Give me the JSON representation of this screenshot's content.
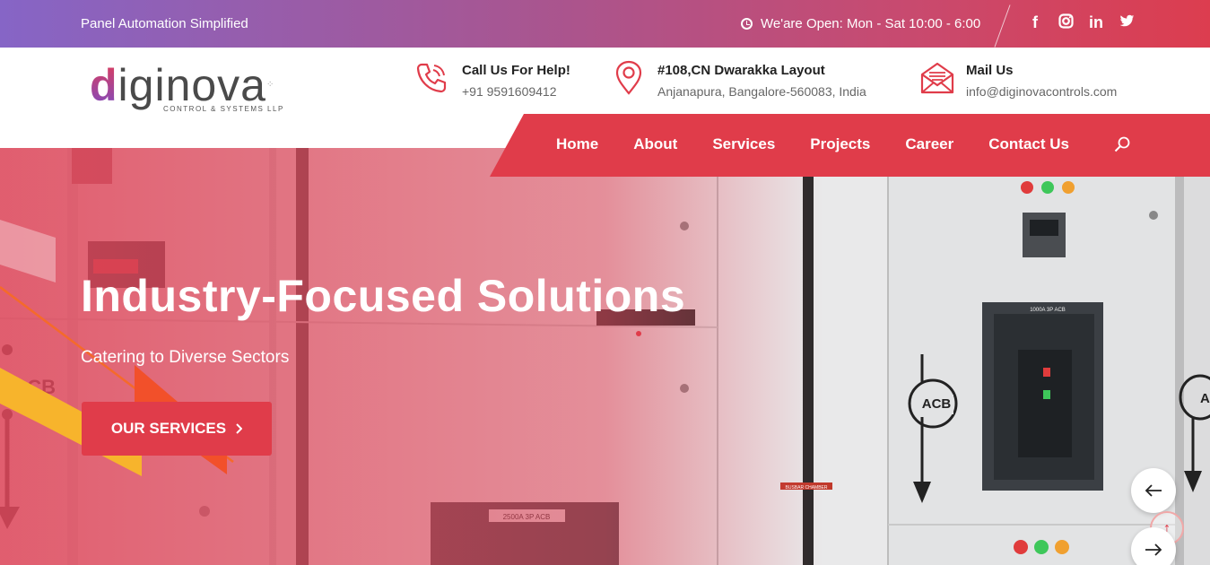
{
  "topbar": {
    "tagline": "Panel Automation Simplified",
    "hours": "We'are Open: Mon - Sat 10:00 - 6:00",
    "social": [
      {
        "icon": "facebook-icon",
        "glyph": "f"
      },
      {
        "icon": "instagram-icon",
        "glyph": "◙"
      },
      {
        "icon": "linkedin-icon",
        "glyph": "in"
      },
      {
        "icon": "twitter-icon",
        "glyph": "🐦"
      }
    ]
  },
  "logo": {
    "wordmark_first": "d",
    "wordmark_rest": "iginova",
    "subtitle": "CONTROL & SYSTEMS LLP"
  },
  "contacts": {
    "call": {
      "title": "Call Us For Help!",
      "value": "+91 9591609412",
      "icon": "phone-icon"
    },
    "address": {
      "title": "#108,CN Dwarakka Layout",
      "value": "Anjanapura, Bangalore-560083, India",
      "icon": "location-pin-icon"
    },
    "mail": {
      "title": "Mail Us",
      "value": "info@diginovacontrols.com",
      "icon": "mail-icon"
    }
  },
  "nav": {
    "items": [
      "Home",
      "About",
      "Services",
      "Projects",
      "Career",
      "Contact Us"
    ],
    "search_icon": "search-icon"
  },
  "hero": {
    "title": "Industry-Focused Solutions",
    "subtitle": "Catering to Diverse Sectors",
    "button_label": "OUR SERVICES",
    "button_icon": "chevron-right-icon"
  },
  "slider": {
    "prev_icon": "arrow-left-icon",
    "next_icon": "arrow-right-icon",
    "to_top_icon": "arrow-up-icon"
  },
  "colors": {
    "accent": "#e03c4a",
    "gradient_start": "#8665c6",
    "gradient_end": "#dc3d4f"
  }
}
